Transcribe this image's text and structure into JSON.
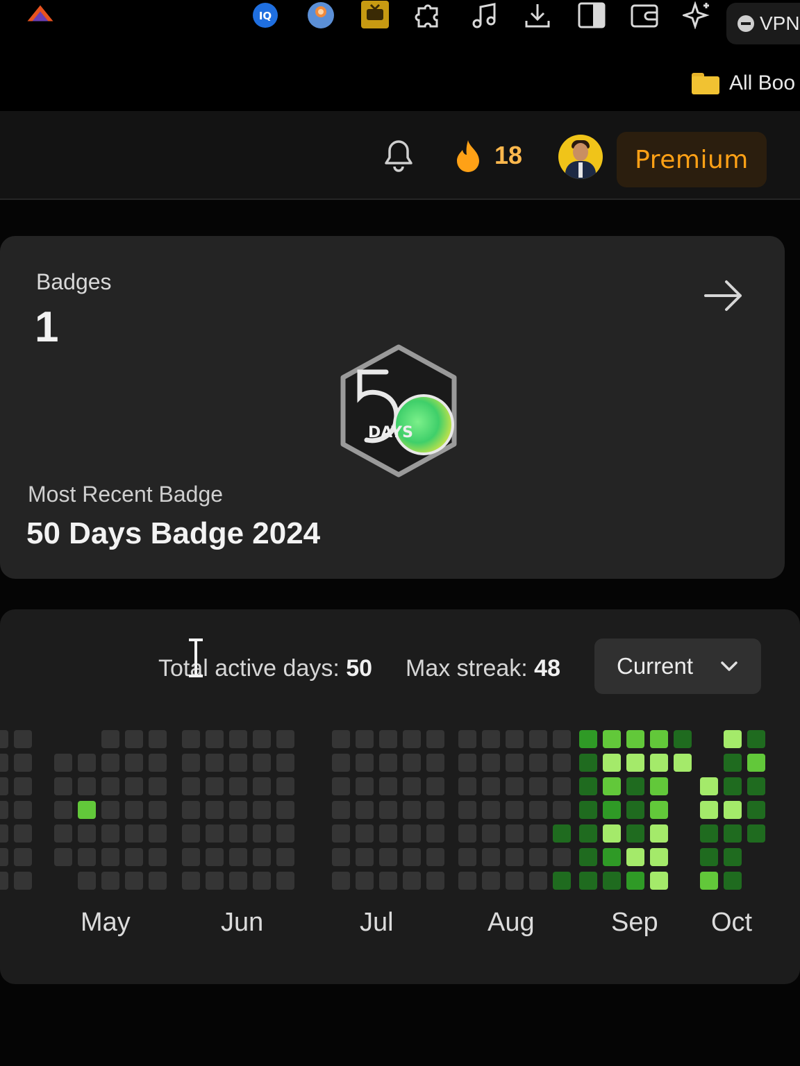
{
  "browser": {
    "vpn_label": "VPN",
    "bookmarks_label": "All Boo"
  },
  "header": {
    "streak_count": "18",
    "premium_label": "Premium"
  },
  "badges": {
    "label": "Badges",
    "count": "1",
    "badge_text": "DAYS",
    "most_recent_label": "Most Recent Badge",
    "most_recent_name": "50 Days Badge 2024"
  },
  "activity": {
    "total_active_label": "Total active days:",
    "total_active_value": "50",
    "max_streak_label": "Max streak:",
    "max_streak_value": "48",
    "range_selected": "Current",
    "months": [
      "May",
      "Jun",
      "Jul",
      "Aug",
      "Sep",
      "Oct"
    ],
    "colors": {
      "empty": "#353535",
      "level1": "#1f6b1f",
      "level2": "#2f9a26",
      "level3": "#62c83a",
      "level4": "#a4ea6a"
    }
  }
}
